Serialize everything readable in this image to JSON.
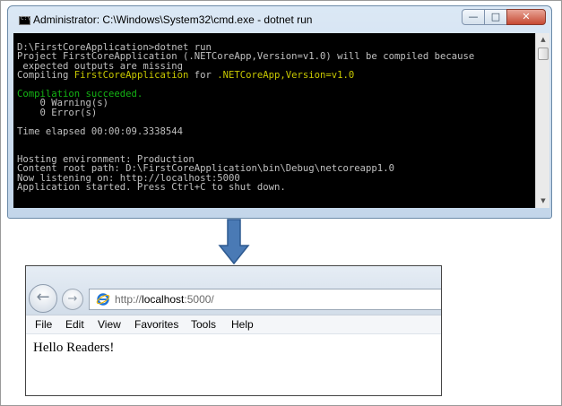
{
  "cmd": {
    "title": "Administrator: C:\\Windows\\System32\\cmd.exe - dotnet  run",
    "buttons": {
      "minimize": "—",
      "maximize": "□",
      "close": "✕"
    },
    "lines": [
      {
        "segments": [
          {
            "text": "D:\\FirstCoreApplication>dotnet run",
            "color": "default"
          }
        ]
      },
      {
        "segments": [
          {
            "text": "Project FirstCoreApplication (.NETCoreApp,Version=v1.0) will be compiled because",
            "color": "default"
          }
        ]
      },
      {
        "segments": [
          {
            "text": " expected outputs are missing",
            "color": "default"
          }
        ]
      },
      {
        "segments": [
          {
            "text": "Compiling ",
            "color": "default"
          },
          {
            "text": "FirstCoreApplication",
            "color": "yellow"
          },
          {
            "text": " for ",
            "color": "default"
          },
          {
            "text": ".NETCoreApp,Version=v1.0",
            "color": "yellow"
          }
        ]
      },
      {
        "segments": [
          {
            "text": "",
            "color": "default"
          }
        ]
      },
      {
        "segments": [
          {
            "text": "Compilation succeeded.",
            "color": "green"
          }
        ]
      },
      {
        "segments": [
          {
            "text": "    0 Warning(s)",
            "color": "default"
          }
        ]
      },
      {
        "segments": [
          {
            "text": "    0 Error(s)",
            "color": "default"
          }
        ]
      },
      {
        "segments": [
          {
            "text": "",
            "color": "default"
          }
        ]
      },
      {
        "segments": [
          {
            "text": "Time elapsed 00:00:09.3338544",
            "color": "default"
          }
        ]
      },
      {
        "segments": [
          {
            "text": "",
            "color": "default"
          }
        ]
      },
      {
        "segments": [
          {
            "text": "",
            "color": "default"
          }
        ]
      },
      {
        "segments": [
          {
            "text": "Hosting environment: Production",
            "color": "default"
          }
        ]
      },
      {
        "segments": [
          {
            "text": "Content root path: D:\\FirstCoreApplication\\bin\\Debug\\netcoreapp1.0",
            "color": "default"
          }
        ]
      },
      {
        "segments": [
          {
            "text": "Now listening on: http://localhost:5000",
            "color": "default"
          }
        ]
      },
      {
        "segments": [
          {
            "text": "Application started. Press Ctrl+C to shut down.",
            "color": "default"
          }
        ]
      }
    ],
    "colors": {
      "background": "#000000",
      "default": "#c0c0c0",
      "yellow": "#c8c800",
      "green": "#14b414"
    }
  },
  "arrow": {
    "color": "#4a7ab5"
  },
  "browser": {
    "back_icon": "←",
    "forward_icon": "→",
    "url_prefix": "http://",
    "url_host": "localhost",
    "url_suffix": ":5000/",
    "menu": [
      "File",
      "Edit",
      "View",
      "Favorites",
      "Tools",
      "Help"
    ],
    "content_text": "Hello Readers!"
  }
}
